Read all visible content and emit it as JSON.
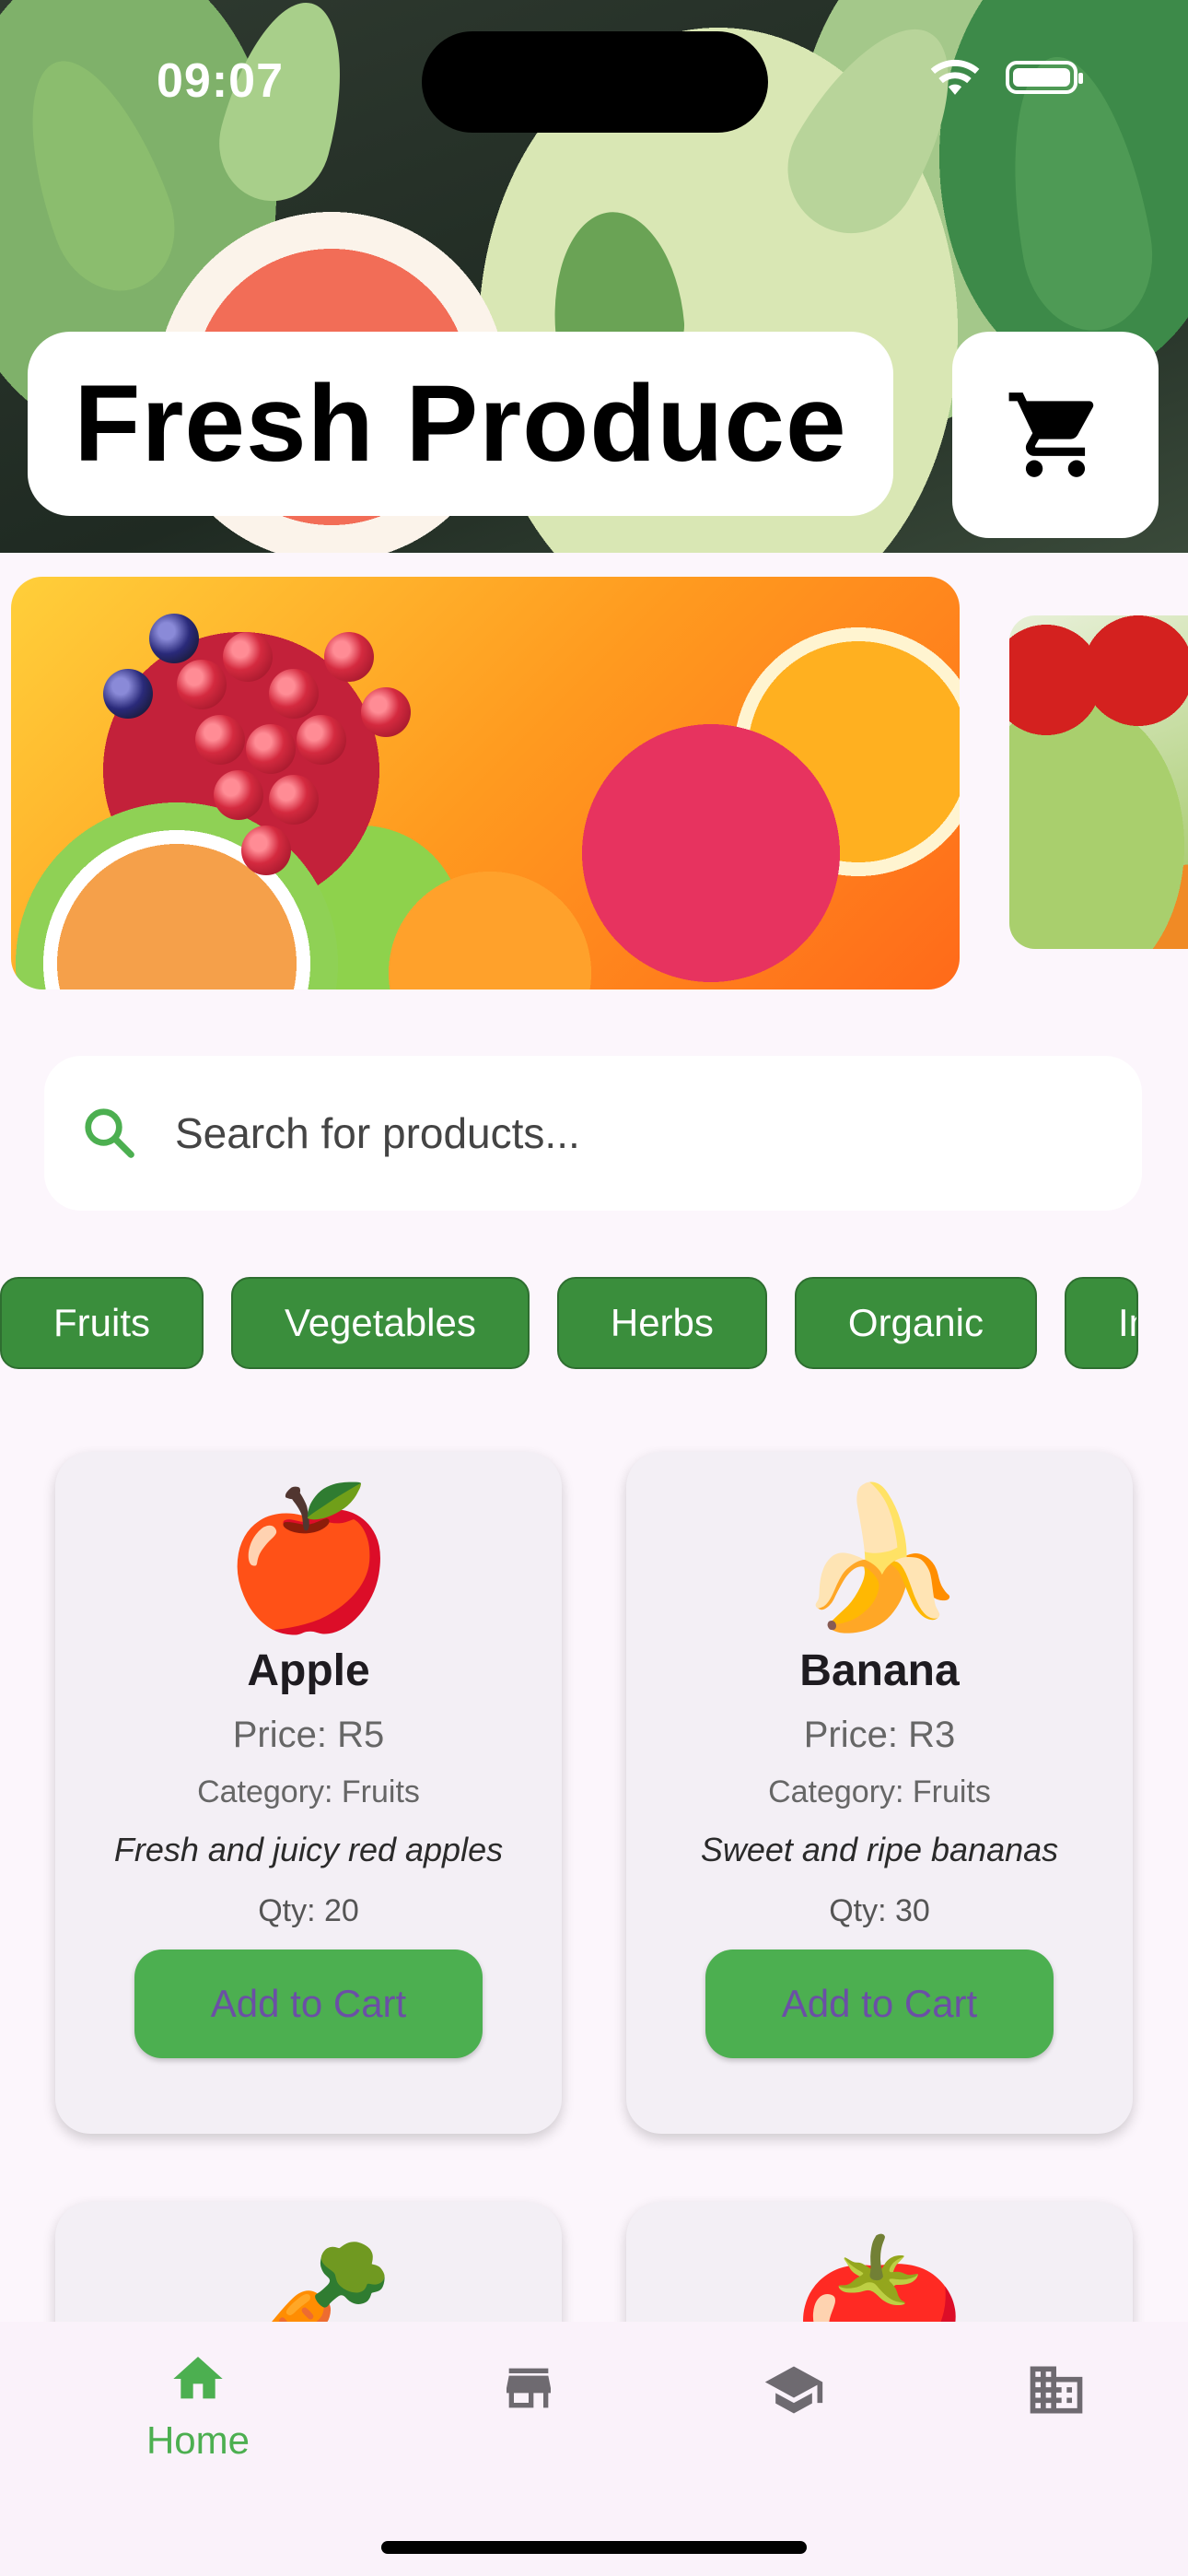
{
  "status_bar": {
    "time": "09:07"
  },
  "header": {
    "title": "Fresh Produce",
    "cart_icon": "cart-icon"
  },
  "search": {
    "placeholder": "Search for products...",
    "icon": "search-icon"
  },
  "categories": [
    "Fruits",
    "Vegetables",
    "Herbs",
    "Organic",
    "Im"
  ],
  "products": [
    {
      "emoji": "🍎",
      "name": "Apple",
      "price": "Price: R5",
      "category": "Category: Fruits",
      "description": "Fresh and juicy red apples",
      "qty": "Qty: 20",
      "button": "Add to Cart"
    },
    {
      "emoji": "🍌",
      "name": "Banana",
      "price": "Price: R3",
      "category": "Category: Fruits",
      "description": "Sweet and ripe bananas",
      "qty": "Qty: 30",
      "button": "Add to Cart"
    },
    {
      "emoji": "🥕"
    },
    {
      "emoji": "🍅"
    }
  ],
  "bottom_nav": {
    "items": [
      {
        "icon": "home-icon",
        "label": "Home",
        "active": true
      },
      {
        "icon": "store-icon",
        "label": "",
        "active": false
      },
      {
        "icon": "school-icon",
        "label": "",
        "active": false
      },
      {
        "icon": "business-icon",
        "label": "",
        "active": false
      }
    ]
  },
  "colors": {
    "accent_green": "#4caf50",
    "chip_green": "#3a8e3c",
    "button_text": "#6b4fa6",
    "background": "#fcf6fc"
  }
}
